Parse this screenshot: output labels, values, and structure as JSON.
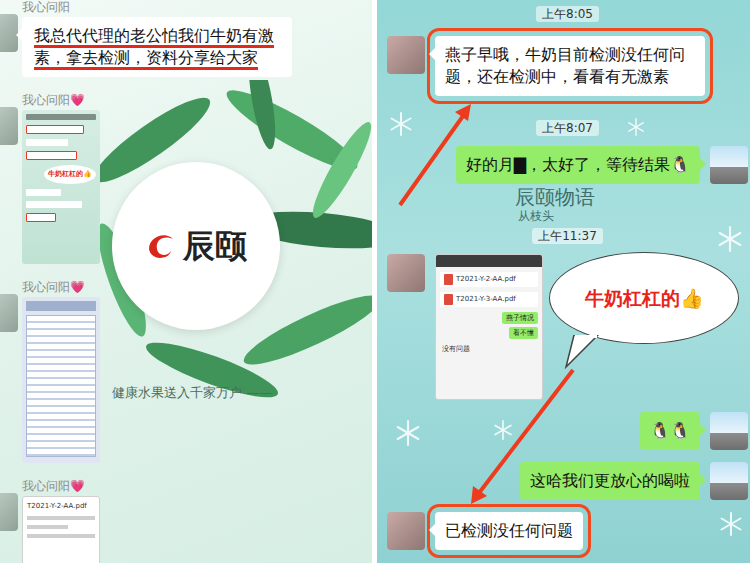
{
  "left": {
    "wallpaper": {
      "logo": "辰颐",
      "slogan": "健康水果送入千家万户 ——"
    },
    "messages": [
      {
        "kind": "text",
        "sender": "我心问阳",
        "text": "我总代代理的老公怕我们牛奶有激素，拿去检测，资料分享给大家",
        "underlined": true
      },
      {
        "kind": "image",
        "sender": "我心问阳💗",
        "thumb": "chat",
        "caption": "牛奶杠杠的👍"
      },
      {
        "kind": "image",
        "sender": "我心问阳💗",
        "thumb": "table"
      },
      {
        "kind": "image",
        "sender": "我心问阳💗",
        "thumb": "doc",
        "caption": "T2021-Y-2-AA.pdf"
      }
    ]
  },
  "right": {
    "wallpaper": {
      "brand": "辰颐物语",
      "tagline": "从枝头"
    },
    "messages": [
      {
        "kind": "time",
        "text": "上午8:05"
      },
      {
        "kind": "text",
        "side": "left",
        "text": "燕子早哦，牛奶目前检测没任何问题，还在检测中，看看有无激素",
        "highlighted": true
      },
      {
        "kind": "time",
        "text": "上午8:07"
      },
      {
        "kind": "text",
        "side": "right",
        "text": "好的月▇，太好了，等待结果🐧",
        "highlighted": false
      },
      {
        "kind": "time",
        "text": "上午11:37"
      },
      {
        "kind": "image",
        "side": "left",
        "files": [
          "T2021-Y-2-AA.pdf",
          "T2021-Y-3-AA.pdf"
        ],
        "buttons": [
          "燕子情况",
          "看不懂"
        ],
        "note": "没有问题"
      },
      {
        "kind": "text",
        "side": "right",
        "text": "🐧🐧",
        "highlighted": false
      },
      {
        "kind": "text",
        "side": "right",
        "text": "这哈我们更放心的喝啦",
        "highlighted": false
      },
      {
        "kind": "text",
        "side": "left",
        "text": "已检测没任何问题",
        "highlighted": true
      }
    ],
    "callout": {
      "text": "牛奶杠杠的👍"
    }
  }
}
